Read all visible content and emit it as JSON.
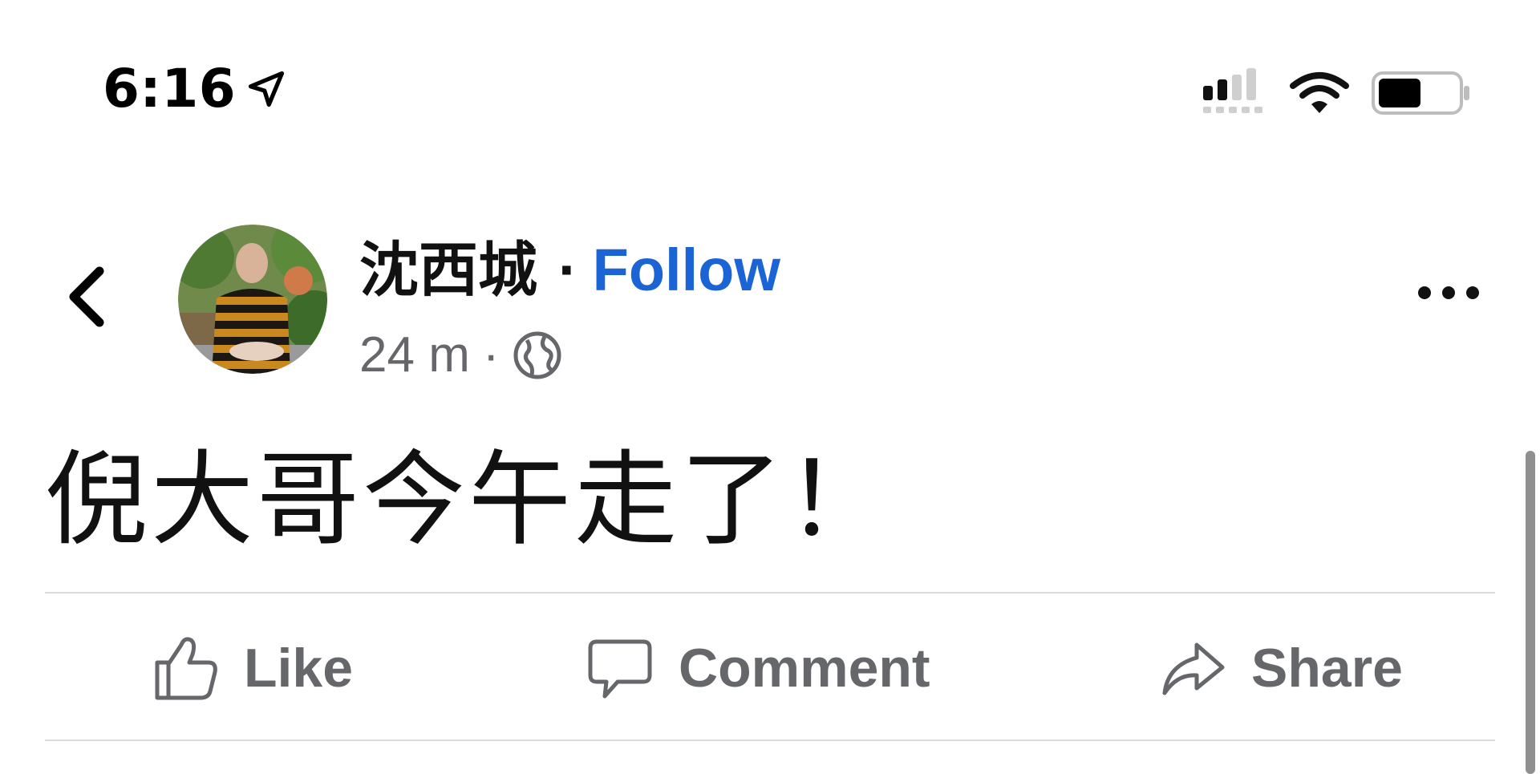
{
  "status_bar": {
    "time": "6:16",
    "icons": [
      "location-arrow-icon",
      "cellular-signal-icon",
      "wifi-icon",
      "battery-icon"
    ]
  },
  "post": {
    "author": "沈西城",
    "separator": "·",
    "follow_label": "Follow",
    "timestamp": "24 m",
    "meta_separator": "·",
    "audience_icon": "globe-icon",
    "text": "倪大哥今午走了！"
  },
  "actions": {
    "like_label": "Like",
    "comment_label": "Comment",
    "share_label": "Share"
  },
  "colors": {
    "follow": "#1a64d6",
    "meta_gray": "#65676b",
    "divider": "#d9dadc"
  }
}
